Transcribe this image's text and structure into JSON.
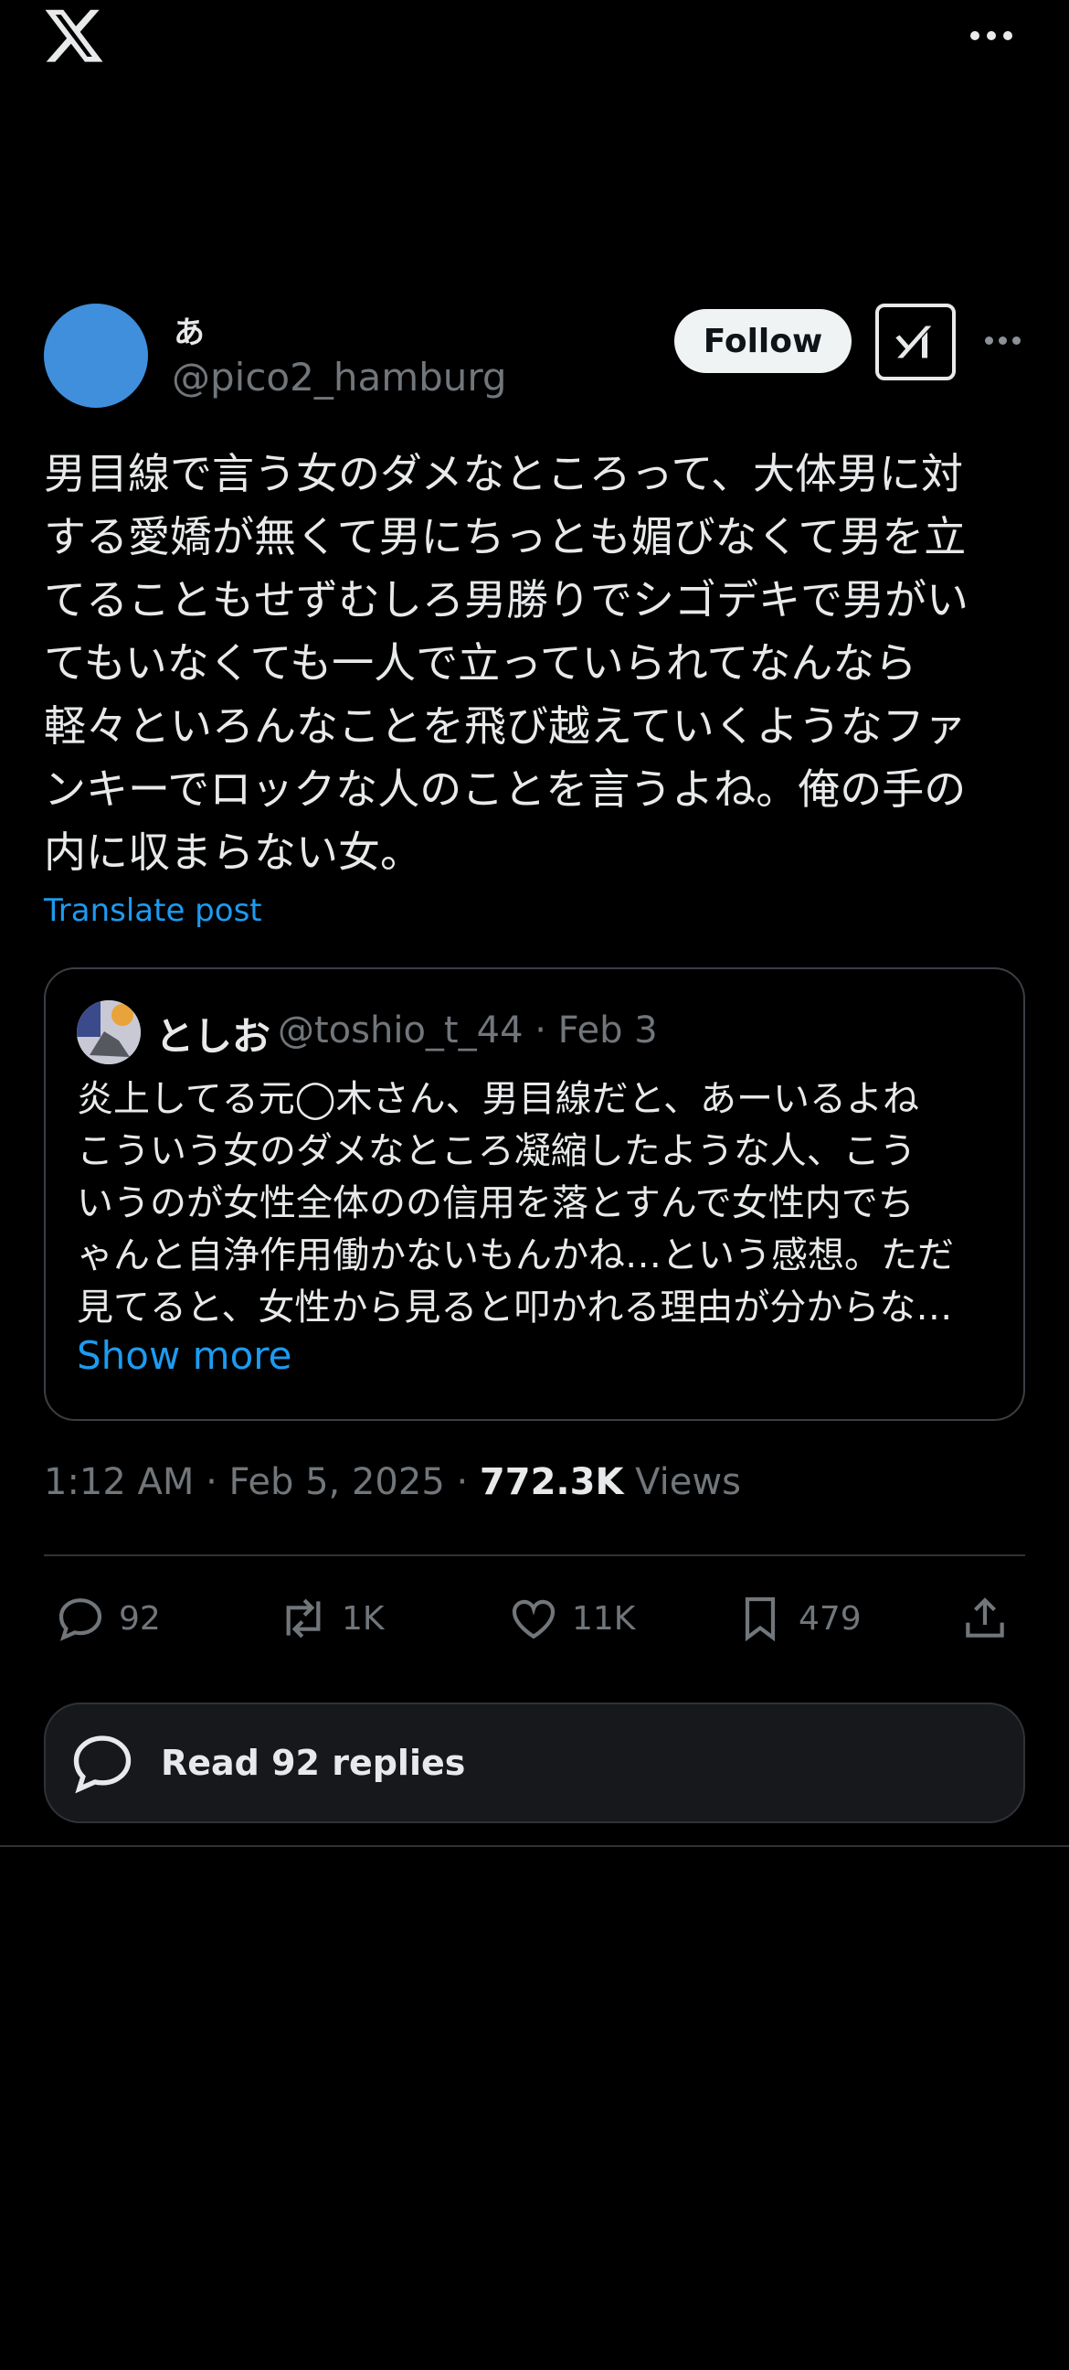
{
  "top_bar": {
    "logo": "x-logo",
    "more": "more-icon"
  },
  "post": {
    "author_name": "あ",
    "author_handle": "@pico2_hamburg",
    "follow_label": "Follow",
    "grok_icon": "grok-icon",
    "text": "男目線で言う女のダメなところって、大体男に対\nする愛嬌が無くて男にちっとも媚びなくて男を立\nてることもせずむしろ男勝りでシゴデキで男がい\nてもいなくても一人で立っていられてなんなら\n軽々といろんなことを飛び越えていくようなファ\nンキーでロックな人のことを言うよね。俺の手の\n内に収まらない女。",
    "translate_label": "Translate post",
    "time": "1:12 AM · Feb 5, 2025 · ",
    "views_count": "772.3K",
    "views_label": " Views"
  },
  "quote": {
    "name": "としお",
    "handle_date": "@toshio_t_44 · Feb 3",
    "text": "炎上してる元◯木さん、男目線だと、あーいるよね\nこういう女のダメなところ凝縮したような人、こう\nいうのが女性全体のの信用を落とすんで女性内でち\nゃんと自浄作用働かないもんかね…という感想。ただ\n見てると、女性から見ると叩かれる理由が分からな…",
    "show_more": "Show more"
  },
  "actions": {
    "replies": "92",
    "reposts": "1K",
    "likes": "11K",
    "bookmarks": "479"
  },
  "read_replies_label": "Read 92 replies",
  "colors": {
    "background": "#000000",
    "accent": "#1d9bf0",
    "avatar": "#3f8fdc",
    "secondary_text": "#71767b"
  }
}
